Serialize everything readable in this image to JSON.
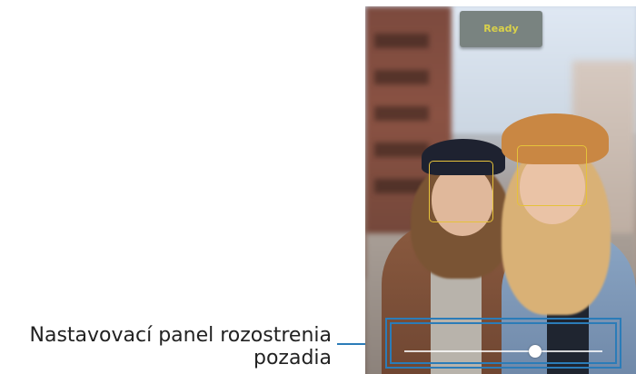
{
  "callout": {
    "label_line1": "Nastavovací panel rozostrenia",
    "label_line2": "pozadia"
  },
  "camera": {
    "ready_label": "Ready",
    "faces_detected": 2
  },
  "blur_slider": {
    "value": 0.66
  },
  "colors": {
    "callout_accent": "#2b7cb8",
    "face_frame": "#e6c23a",
    "ready_text": "#d9d14a"
  }
}
